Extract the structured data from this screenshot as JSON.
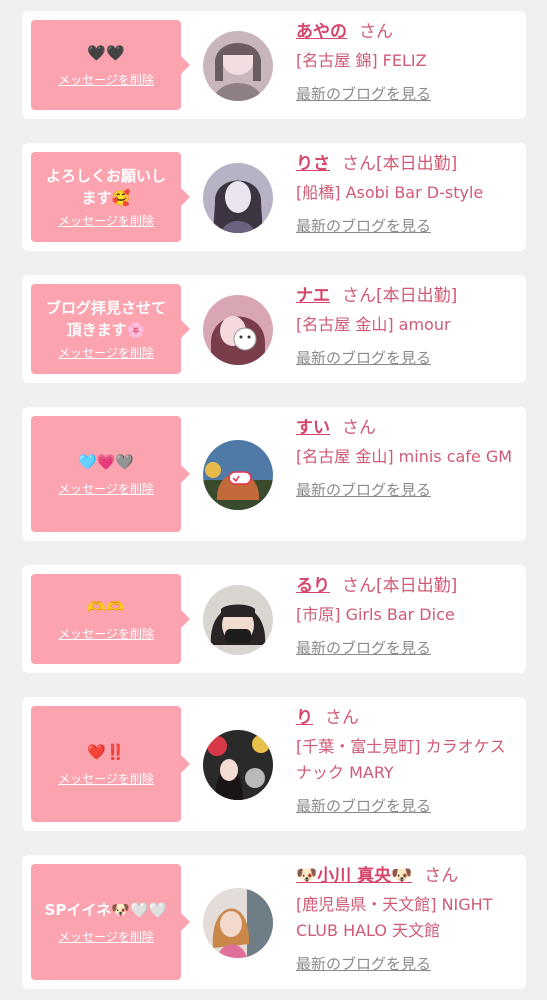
{
  "colors": {
    "background": "#f1eff0",
    "card": "#ffffff",
    "bubble": "#fca3b0",
    "name": "#d5456a",
    "shop": "#d05a75",
    "blog_link": "#8a8a8a"
  },
  "delete_label": "メッセージを削除",
  "blog_label": "最新のブログを見る",
  "items": [
    {
      "message": "🖤🖤",
      "name": "あやの",
      "suffix": "さん",
      "shop": "[名古屋 錦] FELIZ",
      "avatar": "avatar-photo-icon"
    },
    {
      "message": "よろしくお願いし\nます🥰",
      "name": "りさ",
      "suffix": "さん[本日出勤]",
      "shop": "[船橋] Asobi Bar D-style",
      "avatar": "avatar-photo-icon"
    },
    {
      "message": "ブログ拝見させて\n頂きます🌸",
      "name": "ナエ",
      "suffix": "さん[本日出勤]",
      "shop": "[名古屋 金山] amour",
      "avatar": "avatar-photo-icon"
    },
    {
      "message": "🩵💗🩶",
      "name": "すい",
      "suffix": "さん",
      "shop": "[名古屋 金山] minis cafe GM",
      "avatar": "avatar-photo-icon"
    },
    {
      "message": "🫶🫶",
      "name": "るり",
      "suffix": "さん[本日出勤]",
      "shop": "[市原] Girls Bar Dice",
      "avatar": "avatar-photo-icon"
    },
    {
      "message": "❤️‼️",
      "name": "り",
      "suffix": "さん",
      "shop": "[千葉・富士見町] カラオケスナック MARY",
      "avatar": "avatar-photo-icon"
    },
    {
      "message": "SPイイネ🐶🤍🤍",
      "name": "🐶小川 真央🐶",
      "suffix": "さん",
      "shop": "[鹿児島県・天文館] NIGHT CLUB HALO 天文館",
      "avatar": "avatar-photo-icon"
    }
  ]
}
